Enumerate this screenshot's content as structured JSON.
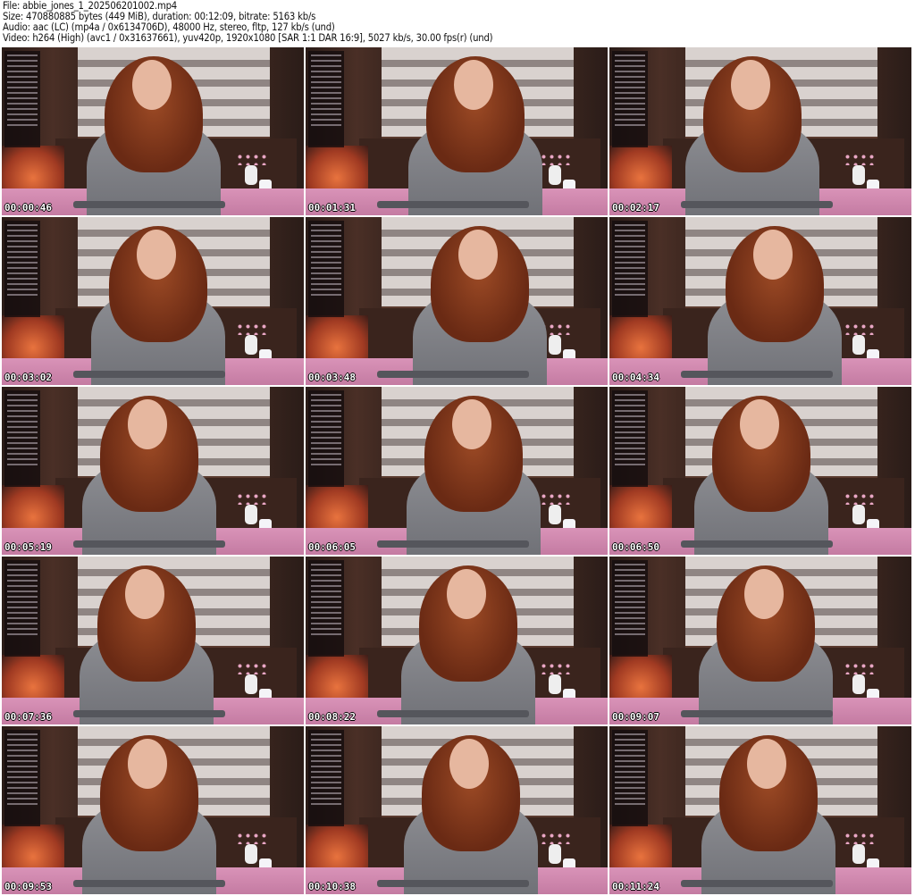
{
  "header": {
    "file": "File: abbie_jones_1_202506201002.mp4",
    "size": "Size: 470880885 bytes (449 MiB), duration: 00:12:09, bitrate: 5163 kb/s",
    "audio": "Audio: aac (LC) (mp4a / 0x6134706D), 48000 Hz, stereo, fltp, 127 kb/s (und)",
    "video": "Video: h264 (High) (avc1 / 0x31637661), yuv420p, 1920x1080 [SAR 1:1 DAR 16:9], 5027 kb/s, 30.00 fps(r) (und)"
  },
  "frames": [
    {
      "timestamp": "00:00:46"
    },
    {
      "timestamp": "00:01:31"
    },
    {
      "timestamp": "00:02:17"
    },
    {
      "timestamp": "00:03:02"
    },
    {
      "timestamp": "00:03:48"
    },
    {
      "timestamp": "00:04:34"
    },
    {
      "timestamp": "00:05:19"
    },
    {
      "timestamp": "00:06:05"
    },
    {
      "timestamp": "00:06:50"
    },
    {
      "timestamp": "00:07:36"
    },
    {
      "timestamp": "00:08:22"
    },
    {
      "timestamp": "00:09:07"
    },
    {
      "timestamp": "00:09:53"
    },
    {
      "timestamp": "00:10:38"
    },
    {
      "timestamp": "00:11:24"
    }
  ]
}
